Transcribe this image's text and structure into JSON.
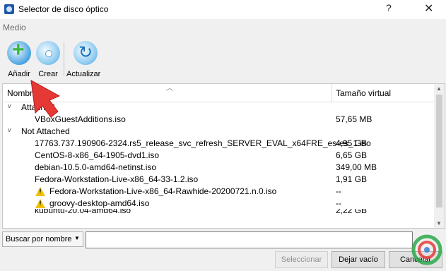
{
  "window": {
    "title": "Selector de disco óptico",
    "help_label": "?",
    "close_label": "✕"
  },
  "menu": {
    "medio": "Medio"
  },
  "toolbar": {
    "add_label": "Añadir",
    "create_label": "Crear",
    "refresh_label": "Actualizar"
  },
  "table": {
    "col_name": "Nombre",
    "col_size": "Tamaño virtual",
    "group_attached": "Attached",
    "group_not_attached": "Not Attached",
    "rows": [
      {
        "name": "VBoxGuestAdditions.iso",
        "size": "57,65 MB"
      },
      {
        "name": "17763.737.190906-2324.rs5_release_svc_refresh_SERVER_EVAL_x64FRE_es-es_1.iso",
        "size": "4,95 GB"
      },
      {
        "name": "CentOS-8-x86_64-1905-dvd1.iso",
        "size": "6,65 GB"
      },
      {
        "name": "debian-10.5.0-amd64-netinst.iso",
        "size": "349,00 MB"
      },
      {
        "name": "Fedora-Workstation-Live-x86_64-33-1.2.iso",
        "size": "1,91 GB"
      },
      {
        "name": "Fedora-Workstation-Live-x86_64-Rawhide-20200721.n.0.iso",
        "size": "--"
      },
      {
        "name": "groovy-desktop-amd64.iso",
        "size": "--"
      },
      {
        "name": "kubuntu-20.04-amd64.iso",
        "size": "2,22 GB"
      }
    ]
  },
  "search": {
    "mode_label": "Buscar por nombre",
    "value": ""
  },
  "buttons": {
    "select_label": "Seleccionar",
    "empty_label": "Dejar vacío",
    "cancel_label": "Cancelar"
  },
  "colors": {
    "accent": "#1e5aa8",
    "warning": "#f2c200",
    "arrow": "#e53935"
  }
}
